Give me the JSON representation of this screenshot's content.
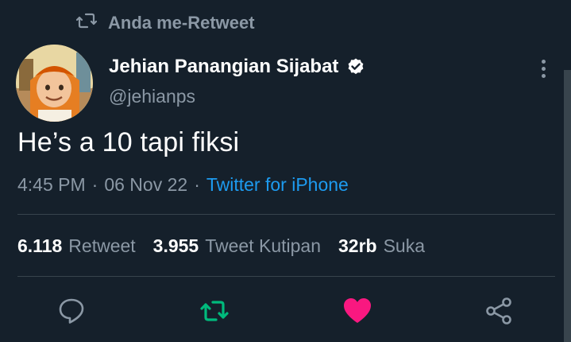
{
  "retweet_context": {
    "text": "Anda me-Retweet",
    "icon": "retweet-icon"
  },
  "author": {
    "name": "Jehian Panangian Sijabat",
    "handle": "@jehianps",
    "verified_icon": "verified-badge-icon"
  },
  "tweet": {
    "text": "He’s a 10 tapi fiksi",
    "time": "4:45 PM",
    "date": "06 Nov 22",
    "separator": "·",
    "source": "Twitter for iPhone"
  },
  "stats": [
    {
      "value": "6.118",
      "label": "Retweet"
    },
    {
      "value": "3.955",
      "label": "Tweet Kutipan"
    },
    {
      "value": "32rb",
      "label": "Suka"
    }
  ],
  "actions": {
    "reply_icon": "reply-icon",
    "retweet_icon": "retweet-icon",
    "like_icon": "heart-icon",
    "share_icon": "share-icon"
  },
  "colors": {
    "background": "#15202b",
    "text_primary": "#ffffff",
    "text_secondary": "#8b98a5",
    "link": "#1d9bf0",
    "retweet_active": "#00ba7c",
    "like_active": "#f91880",
    "divider": "#38444d"
  }
}
